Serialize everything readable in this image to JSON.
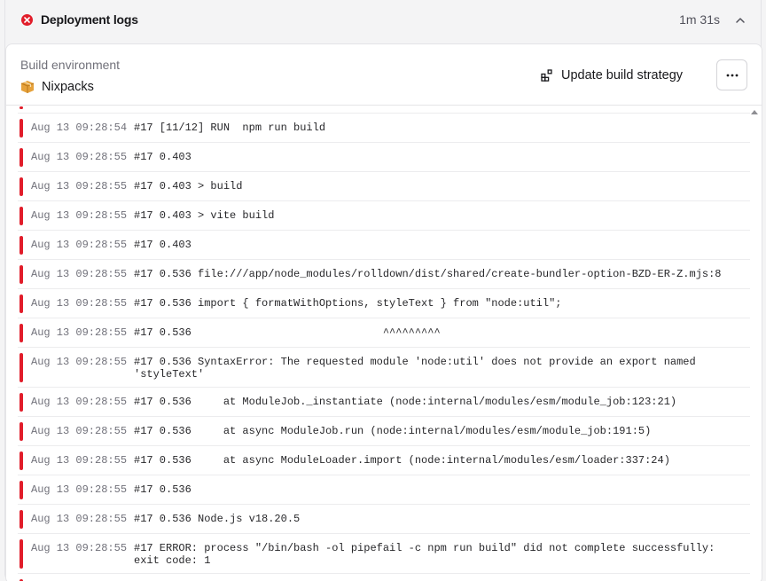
{
  "header": {
    "title": "Deployment logs",
    "duration": "1m 31s"
  },
  "environment": {
    "label": "Build environment",
    "value": "Nixpacks",
    "update_button": "Update build strategy"
  },
  "logs": [
    {
      "ts": "Aug 13 09:28:54",
      "msg": "#17 [11/12] RUN  npm run build"
    },
    {
      "ts": "Aug 13 09:28:55",
      "msg": "#17 0.403"
    },
    {
      "ts": "Aug 13 09:28:55",
      "msg": "#17 0.403 > build"
    },
    {
      "ts": "Aug 13 09:28:55",
      "msg": "#17 0.403 > vite build"
    },
    {
      "ts": "Aug 13 09:28:55",
      "msg": "#17 0.403"
    },
    {
      "ts": "Aug 13 09:28:55",
      "msg": "#17 0.536 file:///app/node_modules/rolldown/dist/shared/create-bundler-option-BZD-ER-Z.mjs:8"
    },
    {
      "ts": "Aug 13 09:28:55",
      "msg": "#17 0.536 import { formatWithOptions, styleText } from \"node:util\";"
    },
    {
      "ts": "Aug 13 09:28:55",
      "msg": "#17 0.536                              ^^^^^^^^^"
    },
    {
      "ts": "Aug 13 09:28:55",
      "msg": "#17 0.536 SyntaxError: The requested module 'node:util' does not provide an export named\n'styleText'"
    },
    {
      "ts": "Aug 13 09:28:55",
      "msg": "#17 0.536     at ModuleJob._instantiate (node:internal/modules/esm/module_job:123:21)"
    },
    {
      "ts": "Aug 13 09:28:55",
      "msg": "#17 0.536     at async ModuleJob.run (node:internal/modules/esm/module_job:191:5)"
    },
    {
      "ts": "Aug 13 09:28:55",
      "msg": "#17 0.536     at async ModuleLoader.import (node:internal/modules/esm/loader:337:24)"
    },
    {
      "ts": "Aug 13 09:28:55",
      "msg": "#17 0.536"
    },
    {
      "ts": "Aug 13 09:28:55",
      "msg": "#17 0.536 Node.js v18.20.5"
    },
    {
      "ts": "Aug 13 09:28:55",
      "msg": "#17 ERROR: process \"/bin/bash -ol pipefail -c npm run build\" did not complete successfully:\nexit code: 1"
    }
  ],
  "colors": {
    "error": "#e11d2a",
    "muted": "#71717a",
    "border": "#e4e4e7"
  },
  "icons": {
    "status": "error-icon",
    "collapse": "chevron-up-icon",
    "environment": "package-icon",
    "strategy": "blocks-icon",
    "menu": "more-horizontal-icon"
  }
}
